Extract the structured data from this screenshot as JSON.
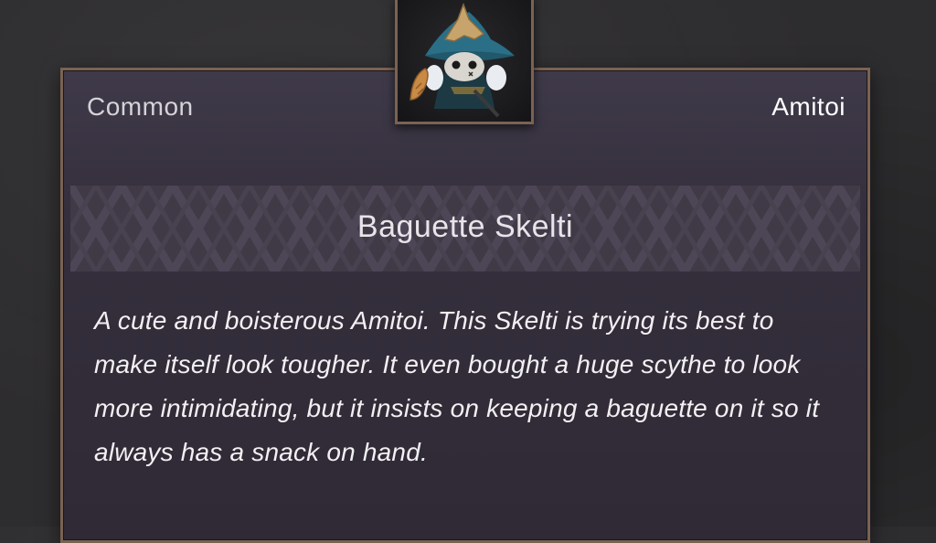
{
  "card": {
    "rarity": "Common",
    "category": "Amitoi",
    "name": "Baguette Skelti",
    "description": "A cute and boisterous Amitoi. This Skelti is trying its best to make itself look tougher. It even bought a huge scythe to look more intimidating, but it insists on keeping a baguette on it so it always has a snack on hand.",
    "portrait_icon": "skelti-amitoi-icon"
  },
  "colors": {
    "background": "#2d2c2e",
    "card_border": "#7a6253",
    "card_fill": "#3a3442",
    "name_band": "#403a47"
  }
}
